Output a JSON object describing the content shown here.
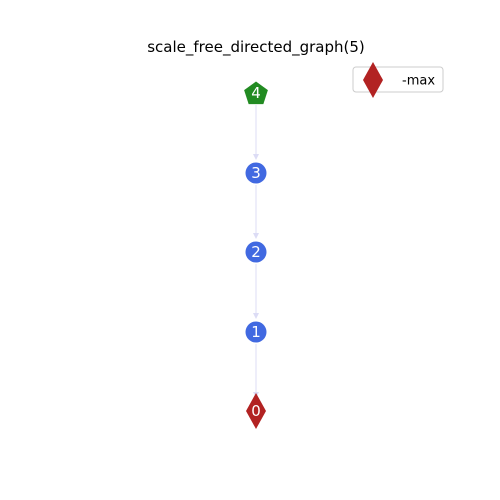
{
  "title": "scale_free_directed_graph(5)",
  "colors": {
    "edge": "#dcdcf5",
    "default_node": "#4169e1",
    "max_node": "#b22222",
    "source_node": "#228b22",
    "node_label": "#ffffff"
  },
  "nodes": [
    {
      "id": "4",
      "label": "4",
      "shape": "pentagon",
      "color": "#228b22"
    },
    {
      "id": "3",
      "label": "3",
      "shape": "circle",
      "color": "#4169e1"
    },
    {
      "id": "2",
      "label": "2",
      "shape": "circle",
      "color": "#4169e1"
    },
    {
      "id": "1",
      "label": "1",
      "shape": "circle",
      "color": "#4169e1"
    },
    {
      "id": "0",
      "label": "0",
      "shape": "diamond",
      "color": "#b22222"
    }
  ],
  "edges": [
    {
      "from": "4",
      "to": "3"
    },
    {
      "from": "3",
      "to": "2"
    },
    {
      "from": "2",
      "to": "1"
    },
    {
      "from": "1",
      "to": "0"
    }
  ],
  "legend": {
    "items": [
      {
        "label": "-max",
        "shape": "diamond",
        "color": "#b22222"
      }
    ]
  }
}
